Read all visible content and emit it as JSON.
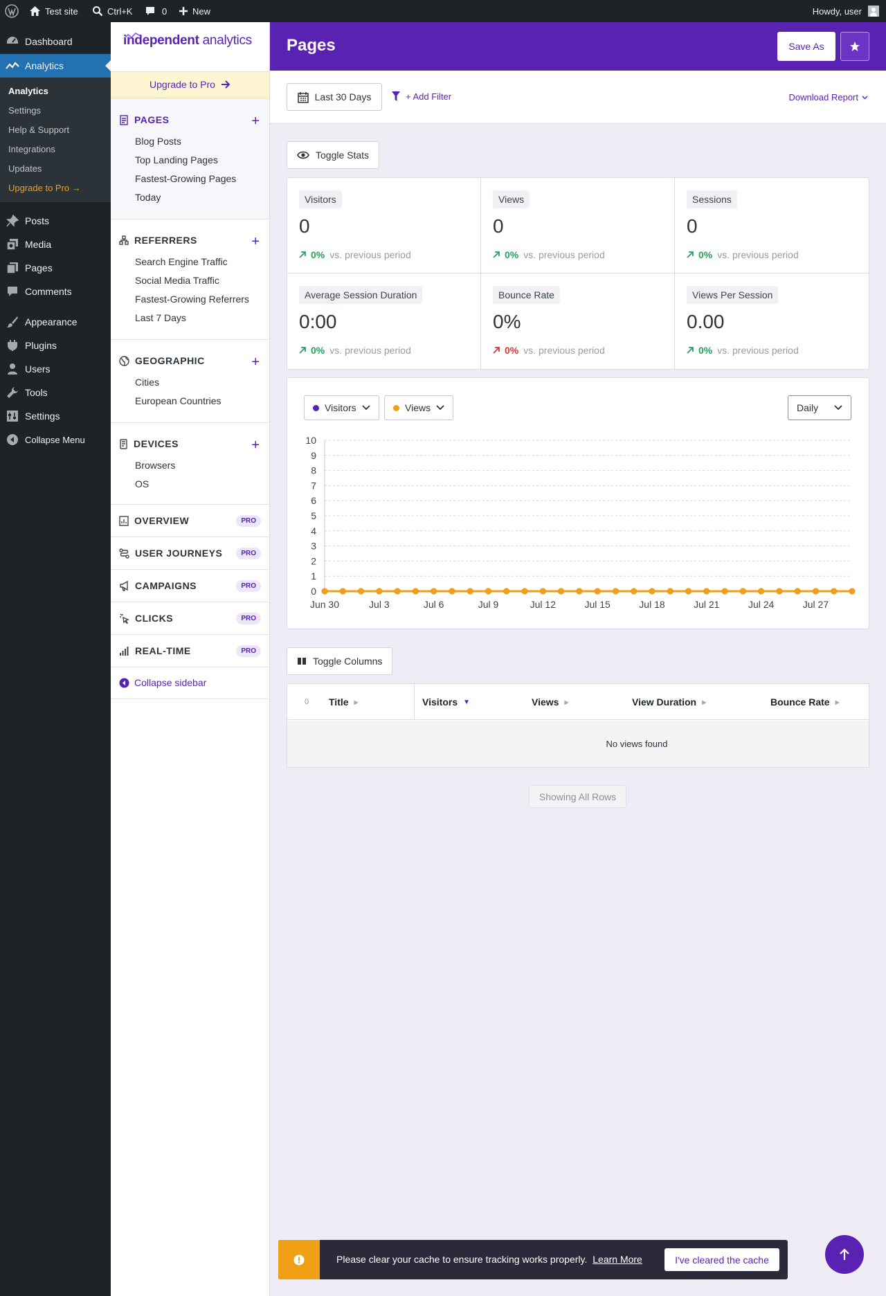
{
  "admin_bar": {
    "site_name": "Test site",
    "search_shortcut": "Ctrl+K",
    "comments_count": "0",
    "new_label": "New",
    "greeting": "Howdy, user"
  },
  "admin_menu": {
    "dashboard": "Dashboard",
    "analytics": "Analytics",
    "submenu": [
      "Analytics",
      "Settings",
      "Help & Support",
      "Integrations",
      "Updates",
      "Upgrade to Pro →"
    ],
    "posts": "Posts",
    "media": "Media",
    "pages": "Pages",
    "comments": "Comments",
    "appearance": "Appearance",
    "plugins": "Plugins",
    "users": "Users",
    "tools": "Tools",
    "settings": "Settings",
    "collapse": "Collapse Menu"
  },
  "plugin_sidebar": {
    "logo_bold": "independent",
    "logo_light": "analytics",
    "upgrade_label": "Upgrade to Pro",
    "sections": {
      "pages": {
        "title": "PAGES",
        "links": [
          "Blog Posts",
          "Top Landing Pages",
          "Fastest-Growing Pages",
          "Today"
        ]
      },
      "referrers": {
        "title": "REFERRERS",
        "links": [
          "Search Engine Traffic",
          "Social Media Traffic",
          "Fastest-Growing Referrers",
          "Last 7 Days"
        ]
      },
      "geographic": {
        "title": "GEOGRAPHIC",
        "links": [
          "Cities",
          "European Countries"
        ]
      },
      "devices": {
        "title": "DEVICES",
        "links": [
          "Browsers",
          "OS"
        ]
      }
    },
    "pro_sections": [
      "OVERVIEW",
      "USER JOURNEYS",
      "CAMPAIGNS",
      "CLICKS",
      "REAL-TIME"
    ],
    "pro_badge": "PRO",
    "collapse_label": "Collapse sidebar"
  },
  "header": {
    "title": "Pages",
    "save_as": "Save As"
  },
  "filters": {
    "date_range": "Last 30 Days",
    "add_filter": "+ Add Filter",
    "download": "Download Report"
  },
  "toggle_stats": "Toggle Stats",
  "stats": [
    {
      "label": "Visitors",
      "value": "0",
      "change": "0%",
      "direction": "up",
      "suffix": "vs. previous period"
    },
    {
      "label": "Views",
      "value": "0",
      "change": "0%",
      "direction": "up",
      "suffix": "vs. previous period"
    },
    {
      "label": "Sessions",
      "value": "0",
      "change": "0%",
      "direction": "up",
      "suffix": "vs. previous period"
    },
    {
      "label": "Average Session Duration",
      "value": "0:00",
      "change": "0%",
      "direction": "up",
      "suffix": "vs. previous period"
    },
    {
      "label": "Bounce Rate",
      "value": "0%",
      "change": "0%",
      "direction": "down",
      "suffix": "vs. previous period"
    },
    {
      "label": "Views Per Session",
      "value": "0.00",
      "change": "0%",
      "direction": "up",
      "suffix": "vs. previous period"
    }
  ],
  "chart_controls": {
    "primary_metric": "Visitors",
    "secondary_metric": "Views",
    "interval": "Daily"
  },
  "colors": {
    "brand_purple": "#5a22b2",
    "visitors_color": "#5a22b2",
    "views_color": "#f0a015",
    "positive": "#24a35a",
    "negative": "#d63638"
  },
  "chart_data": {
    "type": "line",
    "x": [
      "Jun 30",
      "Jul 1",
      "Jul 2",
      "Jul 3",
      "Jul 4",
      "Jul 5",
      "Jul 6",
      "Jul 7",
      "Jul 8",
      "Jul 9",
      "Jul 10",
      "Jul 11",
      "Jul 12",
      "Jul 13",
      "Jul 14",
      "Jul 15",
      "Jul 16",
      "Jul 17",
      "Jul 18",
      "Jul 19",
      "Jul 20",
      "Jul 21",
      "Jul 22",
      "Jul 23",
      "Jul 24",
      "Jul 25",
      "Jul 26",
      "Jul 27",
      "Jul 28",
      "Jul 29"
    ],
    "x_tick_labels": [
      "Jun 30",
      "Jul 3",
      "Jul 6",
      "Jul 9",
      "Jul 12",
      "Jul 15",
      "Jul 18",
      "Jul 21",
      "Jul 24",
      "Jul 27"
    ],
    "series": [
      {
        "name": "Visitors",
        "values": [
          0,
          0,
          0,
          0,
          0,
          0,
          0,
          0,
          0,
          0,
          0,
          0,
          0,
          0,
          0,
          0,
          0,
          0,
          0,
          0,
          0,
          0,
          0,
          0,
          0,
          0,
          0,
          0,
          0,
          0
        ]
      },
      {
        "name": "Views",
        "values": [
          0,
          0,
          0,
          0,
          0,
          0,
          0,
          0,
          0,
          0,
          0,
          0,
          0,
          0,
          0,
          0,
          0,
          0,
          0,
          0,
          0,
          0,
          0,
          0,
          0,
          0,
          0,
          0,
          0,
          0
        ]
      }
    ],
    "ylim": [
      0,
      10
    ],
    "y_ticks": [
      0,
      1,
      2,
      3,
      4,
      5,
      6,
      7,
      8,
      9,
      10
    ],
    "grid": true
  },
  "toggle_columns": "Toggle Columns",
  "table": {
    "count": "0",
    "columns": [
      "Title",
      "Visitors",
      "Views",
      "View Duration",
      "Bounce Rate"
    ],
    "empty_message": "No views found",
    "showing": "Showing All Rows"
  },
  "notice": {
    "message": "Please clear your cache to ensure tracking works properly.",
    "link": "Learn More",
    "button": "I've cleared the cache"
  }
}
